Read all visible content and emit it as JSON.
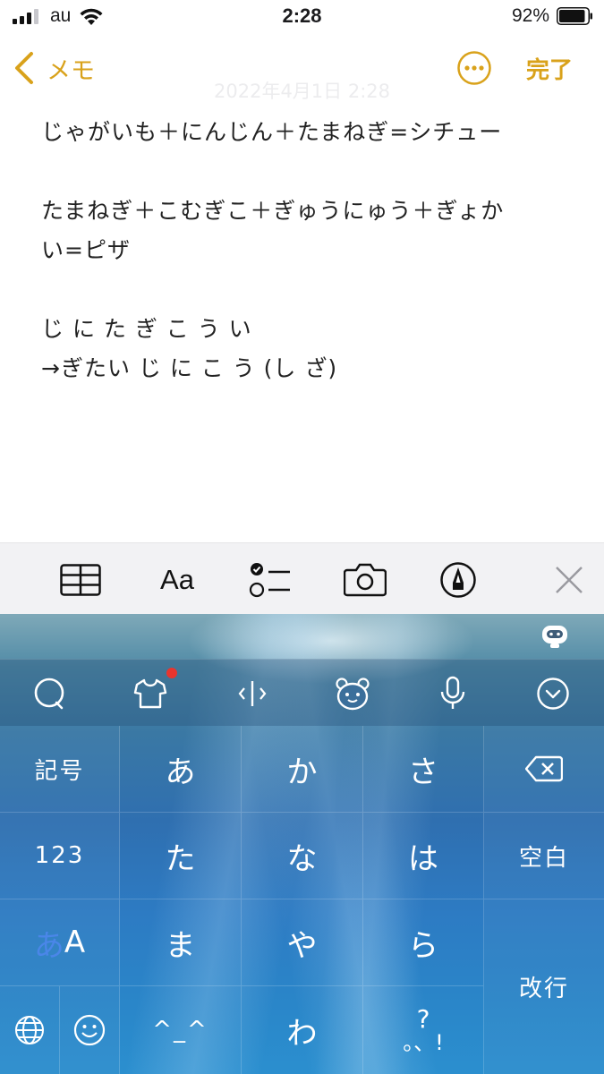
{
  "status": {
    "carrier": "au",
    "time": "2:28",
    "battery_percent": "92%",
    "battery_level": 0.92,
    "icons": [
      "signal-icon",
      "wifi-icon",
      "battery-icon"
    ]
  },
  "nav": {
    "back_label": "メモ",
    "done_label": "完了",
    "icons": [
      "chevron-left-icon",
      "more-icon"
    ],
    "date": "2022年4月1日 2:28"
  },
  "note": {
    "lines": [
      "じゃがいも＋にんじん＋たまねぎ=シチュー",
      "",
      "たまねぎ＋こむぎこ＋ぎゅうにゅう＋ぎょか",
      "い=ピザ",
      "",
      "じ に た ぎ こ う い",
      "→ぎたい じ に こ う (し ざ)"
    ]
  },
  "format_toolbar": {
    "aa_label": "Aa",
    "icons": [
      "table-icon",
      "text-format-icon",
      "checklist-icon",
      "camera-icon",
      "markup-icon",
      "close-icon"
    ]
  },
  "keyboard": {
    "accent": "#2d7bc3",
    "toolbar_icons": [
      "search-icon",
      "skin-icon",
      "cursor-icon",
      "emoji-bear-icon",
      "mic-icon",
      "collapse-icon"
    ],
    "keys": {
      "symbols": "記号",
      "a": "あ",
      "ka": "か",
      "sa": "さ",
      "numbers": "123",
      "ta": "た",
      "na": "な",
      "ha": "は",
      "space": "空白",
      "abc_kana": "あ",
      "abc_latin": "A",
      "ma": "ま",
      "ya": "や",
      "ra": "ら",
      "return": "改行",
      "kaomoji": "^_^",
      "wa": "わ",
      "punct_top": "?",
      "punct_bottom": "。、!"
    }
  }
}
